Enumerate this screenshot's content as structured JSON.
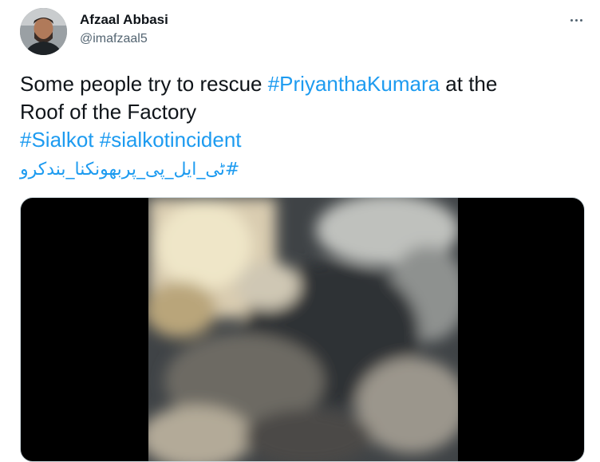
{
  "tweet": {
    "author_name": "Afzaal Abbasi",
    "author_handle": "@imafzaal5",
    "text_plain_1": "Some people try to rescue ",
    "hashtag_1": "#PriyanthaKumara",
    "text_plain_2": " at the",
    "text_plain_3": "Roof of the Factory",
    "hashtag_2": "#Sialkot",
    "hashtag_3": "#sialkotincident",
    "hashtag_4": "#ٹی_ایل_پی_پربھونکنا_بندکرو"
  },
  "icons": {
    "more": "more-options-icon",
    "avatar": "profile-avatar"
  },
  "colors": {
    "link": "#1d9bf0",
    "text": "#0f1419",
    "secondary": "#536471",
    "media_bg": "#000000"
  }
}
